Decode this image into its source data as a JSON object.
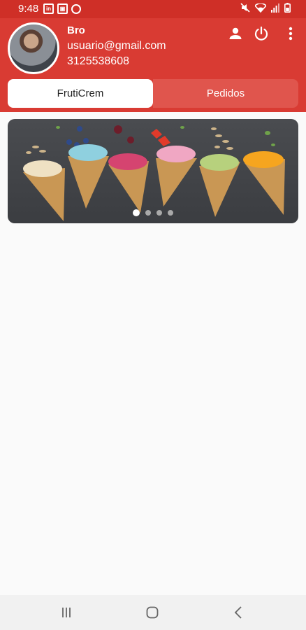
{
  "status_bar": {
    "time": "9:48",
    "icons": [
      "linkedin-icon",
      "photo-icon",
      "chrome-icon",
      "mute-icon",
      "wifi-icon",
      "signal-icon",
      "battery-icon"
    ],
    "badge_in": "in",
    "badge_photo": "▣"
  },
  "profile": {
    "name": "Bro",
    "email": "usuario@gmail.com",
    "phone": "3125538608"
  },
  "tabs": [
    {
      "label": "FrutiCrem",
      "active": true
    },
    {
      "label": "Pedidos",
      "active": false
    }
  ],
  "banner": {
    "page_count": 4,
    "active_page": 1
  },
  "colors": {
    "status_bar": "#cf2f27",
    "header": "#d93b33",
    "tab_inactive": "#e0554d",
    "background": "#fafafa"
  }
}
